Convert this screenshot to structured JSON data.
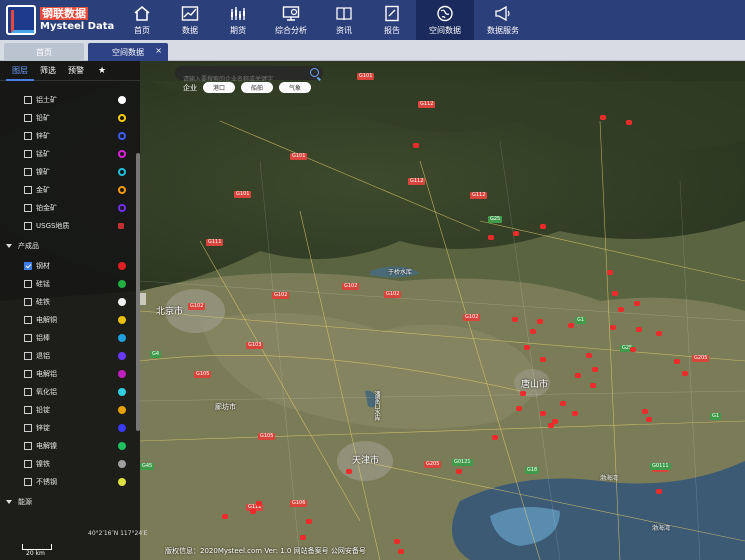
{
  "app": {
    "logo_cn": "钢联数据",
    "logo_en": "Mysteel Data"
  },
  "nav": [
    {
      "label": "首页",
      "icon": "home-icon"
    },
    {
      "label": "数据",
      "icon": "chart-icon"
    },
    {
      "label": "期货",
      "icon": "futures-icon"
    },
    {
      "label": "综合分析",
      "icon": "analysis-icon"
    },
    {
      "label": "资讯",
      "icon": "news-icon"
    },
    {
      "label": "报告",
      "icon": "report-icon"
    },
    {
      "label": "空间数据",
      "icon": "globe-icon"
    },
    {
      "label": "数据服务",
      "icon": "megaphone-icon"
    }
  ],
  "tabs": {
    "home": "首页",
    "space": "空间数据",
    "close": "×"
  },
  "search": {
    "placeholder": "请输入要搜索的企业名称或关键字"
  },
  "filters": {
    "plain": "企业",
    "chips": [
      "港口",
      "船舶",
      "气象"
    ]
  },
  "sidebar": {
    "tabs": [
      "图层",
      "筛选",
      "预警"
    ],
    "star": "★",
    "items": [
      {
        "label": "铝土矿",
        "checked": false,
        "color": "#ffffff"
      },
      {
        "label": "铅矿",
        "checked": false,
        "color": "#ffcc00"
      },
      {
        "label": "锌矿",
        "checked": false,
        "color": "#3a5cff"
      },
      {
        "label": "锰矿",
        "checked": false,
        "color": "#e020e0"
      },
      {
        "label": "镍矿",
        "checked": false,
        "color": "#20c0e0"
      },
      {
        "label": "金矿",
        "checked": false,
        "color": "#ff9a00"
      },
      {
        "label": "铂金矿",
        "checked": false,
        "color": "#7030ff"
      },
      {
        "label": "USGS地质",
        "checked": false,
        "color": "#c03030"
      }
    ],
    "group_products": "产成品",
    "products": [
      {
        "label": "钢材",
        "checked": true,
        "color": "#e02020"
      },
      {
        "label": "硅锰",
        "checked": false,
        "color": "#20b040"
      },
      {
        "label": "硅铁",
        "checked": false,
        "color": "#f0f0f0"
      },
      {
        "label": "电解铜",
        "checked": false,
        "color": "#e8c000"
      },
      {
        "label": "铝棒",
        "checked": false,
        "color": "#20a0e0"
      },
      {
        "label": "退铝",
        "checked": false,
        "color": "#6a3aff"
      },
      {
        "label": "电解铝",
        "checked": false,
        "color": "#c020c0"
      },
      {
        "label": "氧化铝",
        "checked": false,
        "color": "#30d0e0"
      },
      {
        "label": "铅锭",
        "checked": false,
        "color": "#e8a000"
      },
      {
        "label": "锌锭",
        "checked": false,
        "color": "#3a3aff"
      },
      {
        "label": "电解镍",
        "checked": false,
        "color": "#20c060"
      },
      {
        "label": "镍铁",
        "checked": false,
        "color": "#a0a0a0"
      },
      {
        "label": "不锈钢",
        "checked": false,
        "color": "#e0e040"
      }
    ],
    "group_energy": "能源"
  },
  "map": {
    "cities": [
      {
        "name": "北京市",
        "size": "big"
      },
      {
        "name": "天津市",
        "size": "big"
      },
      {
        "name": "唐山市",
        "size": "big"
      },
      {
        "name": "廊坊市",
        "size": "mid"
      }
    ],
    "water": [
      "于桥水库",
      "潘家口水库",
      "渤海湾",
      "渤海湾"
    ],
    "scale": "20 km",
    "coords": "40°2′16″N\n117°24′E"
  },
  "footer": "版权信息：2020Mysteel.com Ver: 1.0 网站备案号 公网安备号"
}
